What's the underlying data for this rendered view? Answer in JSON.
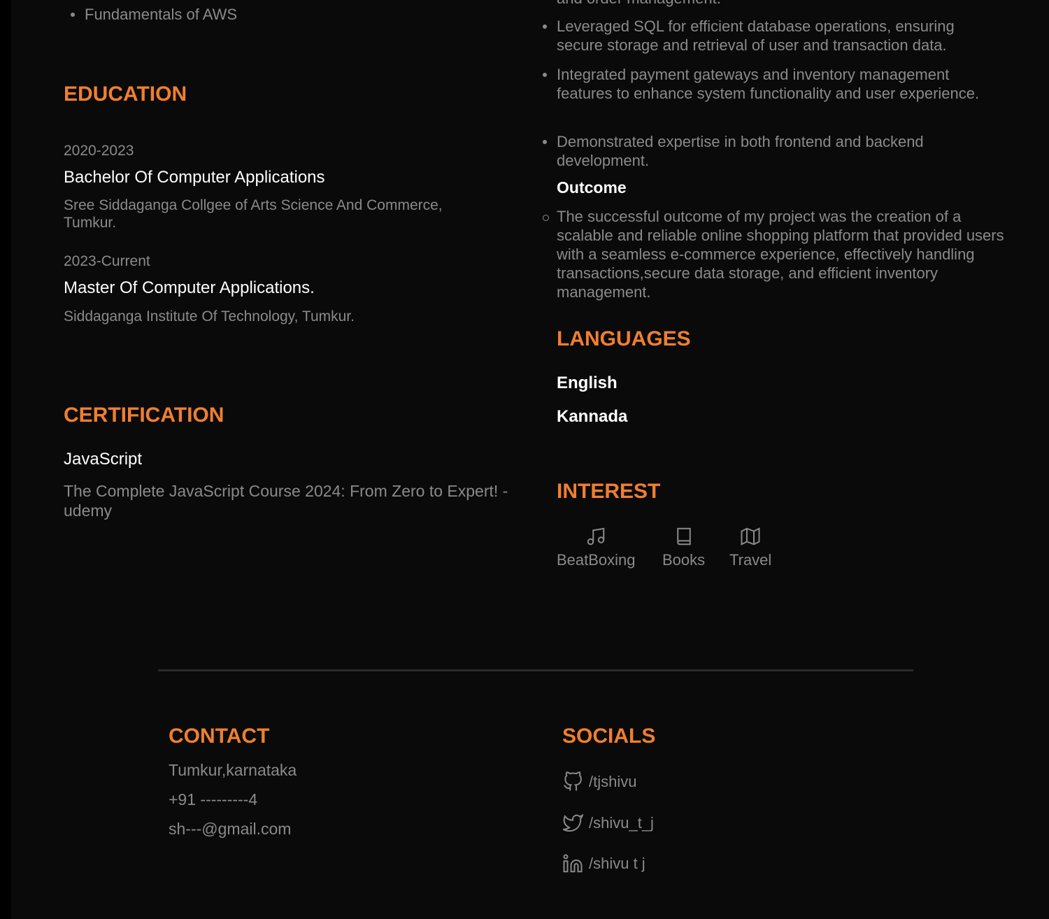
{
  "skills": {
    "last_item": "Fundamentals of AWS"
  },
  "education": {
    "heading": "EDUCATION",
    "items": [
      {
        "years": "2020-2023",
        "degree": "Bachelor Of Computer Applications",
        "school": "Sree Siddaganga Collgee of Arts Science And Commerce, Tumkur."
      },
      {
        "years": "2023-Current",
        "degree": "Master Of Computer Applications.",
        "school": "Siddaganga Institute Of Technology, Tumkur."
      }
    ]
  },
  "certification": {
    "heading": "CERTIFICATION",
    "title": "JavaScript",
    "desc": "The Complete JavaScript Course 2024: From Zero to Expert! - udemy"
  },
  "project": {
    "partial": "and order management.",
    "bullets": [
      "Leveraged SQL for efficient database operations, ensuring secure storage and retrieval of user and transaction data.",
      "Integrated payment gateways and inventory management features to enhance system functionality and user experience.",
      "Demonstrated expertise in both frontend and backend development."
    ],
    "outcome_label": "Outcome",
    "outcome": "The successful outcome of my project was the creation of a scalable and reliable online shopping platform that provided users with a seamless e-commerce experience, effectively handling transactions,secure data storage, and efficient inventory management."
  },
  "languages": {
    "heading": "LANGUAGES",
    "items": [
      "English",
      "Kannada"
    ]
  },
  "interest": {
    "heading": "INTEREST",
    "items": [
      {
        "label": "BeatBoxing",
        "icon": "music-icon"
      },
      {
        "label": "Books",
        "icon": "book-icon"
      },
      {
        "label": "Travel",
        "icon": "map-icon"
      }
    ]
  },
  "contact": {
    "heading": "CONTACT",
    "location": "Tumkur,karnataka",
    "phone": "+91 ---------4",
    "email": "sh---@gmail.com"
  },
  "socials": {
    "heading": "SOCIALS",
    "github": "/tjshivu",
    "twitter": "/shivu_t_j",
    "linkedin": "/shivu t j"
  },
  "colors": {
    "accent": "#f07f2f",
    "bg": "#0a0a0a",
    "muted": "#8a8a8a"
  }
}
